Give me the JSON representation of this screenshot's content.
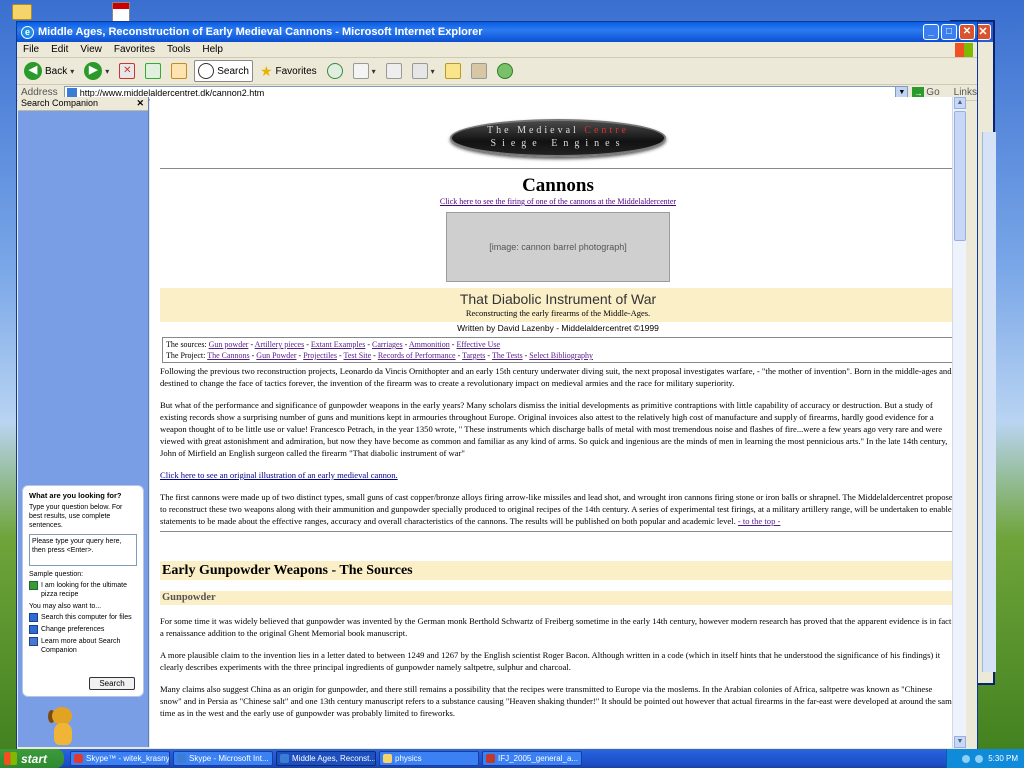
{
  "window": {
    "title": "Middle Ages, Reconstruction of Early Medieval Cannons - Microsoft Internet Explorer",
    "minimize": "_",
    "maximize": "□",
    "close": "✕"
  },
  "menu": [
    "File",
    "Edit",
    "View",
    "Favorites",
    "Tools",
    "Help"
  ],
  "toolbar": {
    "back": "Back",
    "search": "Search",
    "favorites": "Favorites"
  },
  "address": {
    "label": "Address",
    "url": "http://www.middelaldercentret.dk/cannon2.htm",
    "go": "Go",
    "links": "Links"
  },
  "companion": {
    "title": "Search Companion",
    "close": "✕",
    "heading": "What are you looking for?",
    "instructions": "Type your question below. For best results, use complete sentences.",
    "input_value": "Please type your query here, then press <Enter>.",
    "sample_label": "Sample question:",
    "sample": "I am looking for the ultimate pizza recipe",
    "also_label": "You may also want to...",
    "links": [
      "Search this computer for files",
      "Change preferences",
      "Learn more about Search Companion"
    ],
    "search_button": "Search"
  },
  "page": {
    "logo_line1_a": "The Medieval",
    "logo_line1_b": "Centre",
    "logo_line2": "Siege Engines",
    "cannons_title": "Cannons",
    "cannons_link": "Click here to see the firing of one of the cannons at the Middelaldercenter",
    "banner_title": "That Diabolic Instrument of War",
    "banner_subtitle": "Reconstructing the early firearms of the Middle-Ages.",
    "written": "Written by David Lazenby - Middelaldercentret ©1999",
    "sources_label": "The sources:",
    "sources_links": [
      "Gun powder",
      "Artillery pieces",
      "Extant Examples",
      "Carriages",
      "Ammonition",
      "Effective Use"
    ],
    "project_label": "The Project:",
    "project_links": [
      "The Cannons",
      "Gun Powder",
      "Projectiles",
      "Test Site",
      "Records of Performance",
      "Targets",
      "The Tests",
      "Select Bibliography"
    ],
    "para1": "Following the previous two reconstruction projects, Leonardo da Vincis Ornithopter and an early 15th century underwater diving suit, the next proposal investigates warfare, - \"the mother of invention\". Born in the middle-ages and destined to change the face of tactics forever, the invention of the firearm was to create a revolutionary impact on medieval armies and the race for military superiority.",
    "para2": "But what of the performance and significance of gunpowder weapons in the early years? Many scholars dismiss the initial developments as primitive contraptions with little capability of accuracy or destruction. But a study of existing records show a surprising number of guns and munitions kept in armouries throughout Europe. Original invoices also attest to the relatively high cost of manufacture and supply of firearms, hardly good evidence for a weapon thought of to be little use or value! Francesco Petrach, in the year 1350 wrote, \" These instruments which discharge balls of metal with most tremendous noise and flashes of fire...were a few years ago very rare and were viewed with great astonishment and admiration, but now they have become as common and familiar as any kind of arms. So quick and ingenious are the minds of men in learning the most pennicious arts.\" In the late 14th century, John of Mirfield an English surgeon called the firearm \"That diabolic instrument of war\"",
    "illustration_link": "Click here to see an original illustration of an early medieval cannon.",
    "para3": "The first cannons were made up of two distinct types, small guns of cast copper/bronze alloys firing arrow-like missiles and lead shot, and wrought iron cannons firing stone or iron balls or shrapnel. The Middelaldercentret proposes to reconstruct these two weapons along with their ammunition and gunpowder specially produced to original recipes of the 14th century. A series of experimental test firings, at a military artillery range, will be undertaken to enable statements to be made about the effective ranges, accuracy and overall characteristics of the cannons. The results will be published on both popular and academic level.",
    "to_top": "- to the top -",
    "section_title": "Early Gunpowder Weapons - The Sources",
    "sub_title": "Gunpowder",
    "para4": "For some time it was widely believed that gunpowder was invented by the German monk Berthold Schwartz of Freiberg sometime in the early 14th century, however modern research has proved that the apparent evidence is in fact a renaissance addition to the original Ghent Memorial book manuscript.",
    "para5": "A more plausible claim to the invention lies in a letter dated to between 1249 and 1267 by the English scientist Roger Bacon. Although written in a code (which in itself hints that he understood the significance of his findings) it clearly describes experiments with the three principal ingredients of gunpowder namely saltpetre, sulphur and charcoal.",
    "para6": "Many claims also suggest China as an origin for gunpowder, and there still remains a possibility that the recipes were transmitted to Europe via the moslems. In the Arabian colonies of Africa, saltpetre was known as \"Chinese snow\" and in Persia as \"Chinese salt\" and one 13th century manuscript refers to a substance causing \"Heaven shaking thunder!\" It should be pointed out however that actual firearms in the far-east were developed at around the same time as in the west and the early use of gunpowder was probably limited to fireworks."
  },
  "taskbar": {
    "start": "start",
    "tasks": [
      {
        "label": "Skype™ - witek_krasny",
        "color": "#e03a2e"
      },
      {
        "label": "Skype - Microsoft Int...",
        "color": "#3b7cd4"
      },
      {
        "label": "Middle Ages, Reconst...",
        "color": "#3b7cd4"
      },
      {
        "label": "physics",
        "color": "#f5d56b"
      },
      {
        "label": "IFJ_2005_general_a...",
        "color": "#c0392b"
      }
    ],
    "clock": "5:30 PM"
  }
}
